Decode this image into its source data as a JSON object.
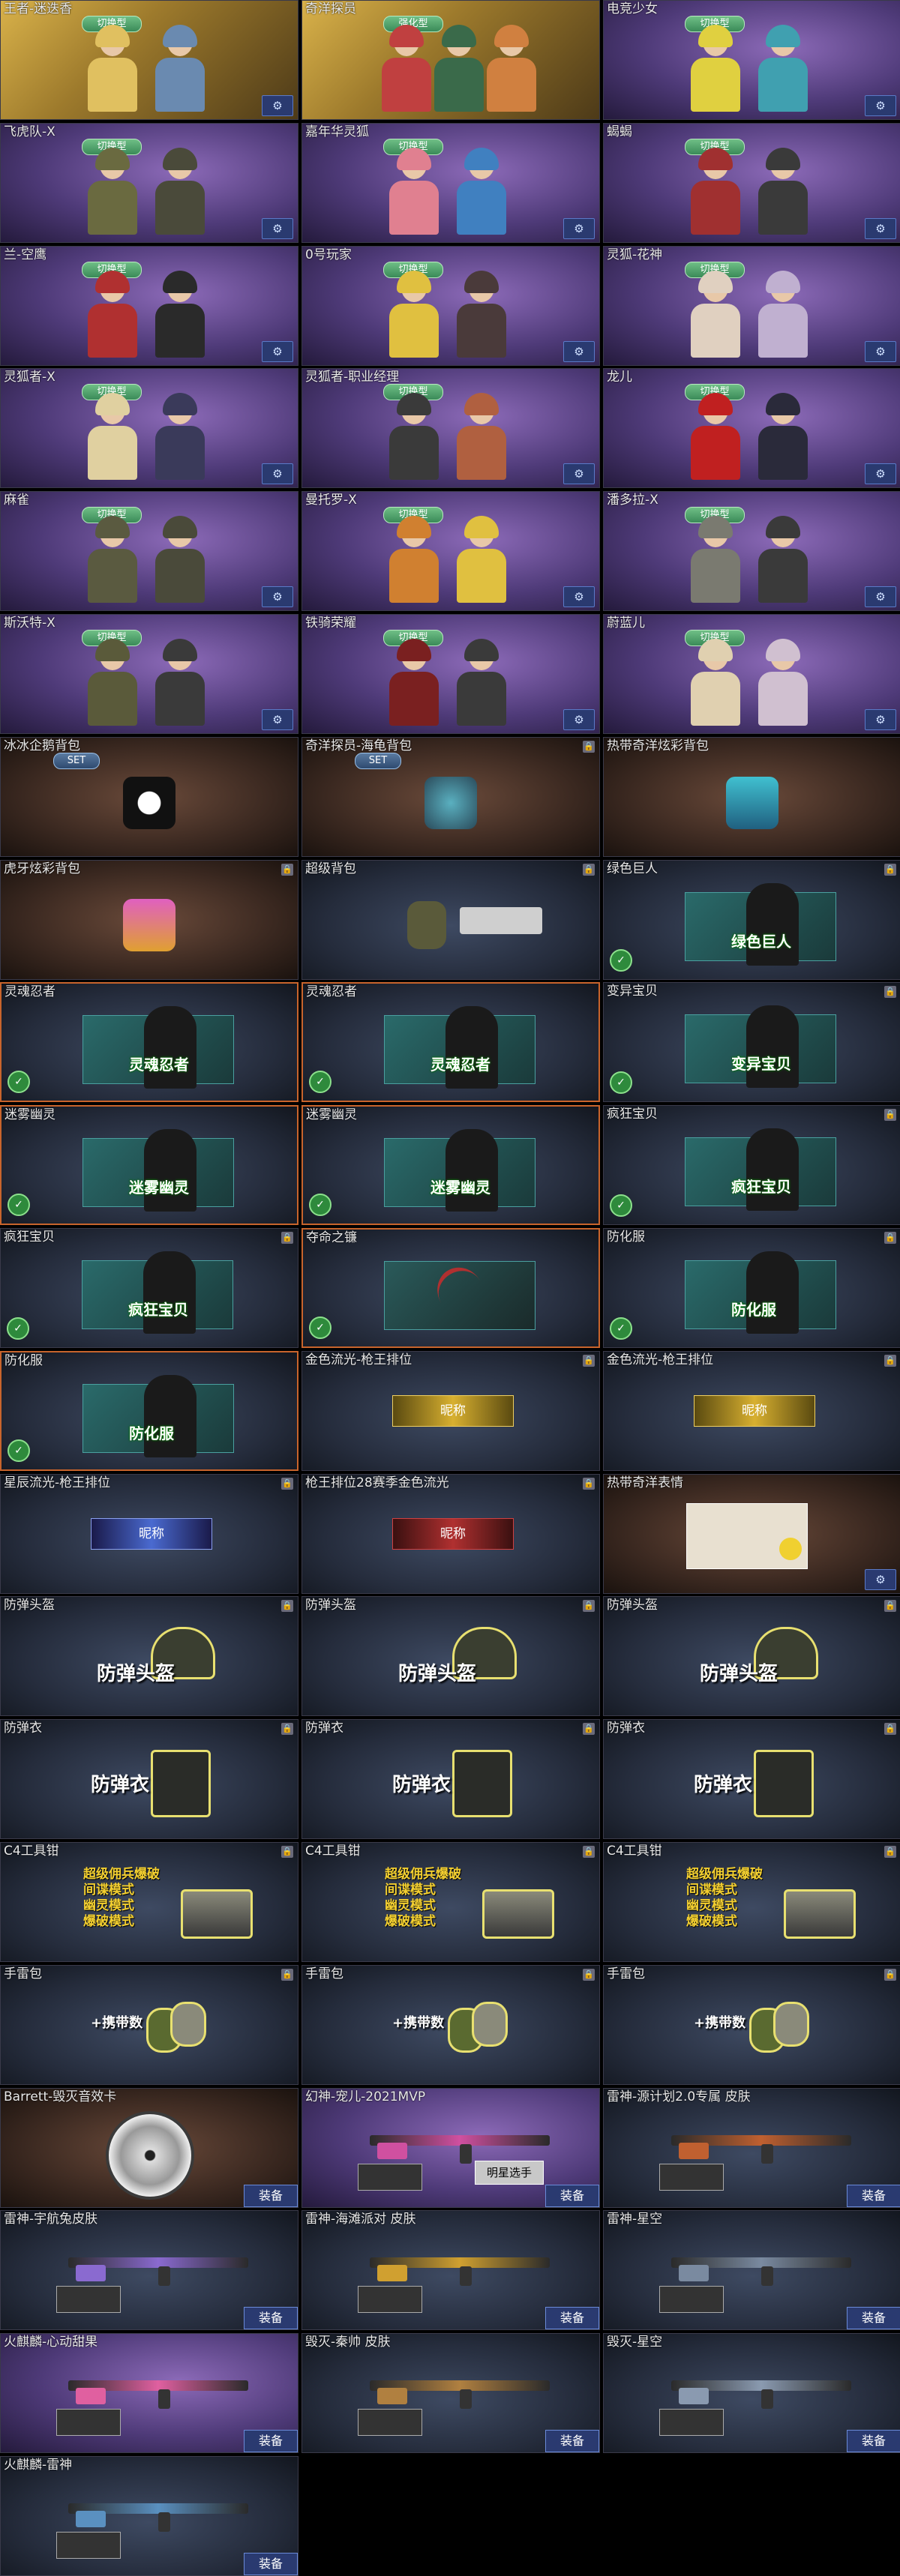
{
  "labels": {
    "gear": "⚙",
    "lock": "🔒",
    "equip": "装备",
    "tick": "✓"
  },
  "cards": [
    {
      "title": "王者-迷迭香",
      "style": "gold",
      "kind": "char",
      "badge": "切换型",
      "gear": true,
      "colors": [
        "#e0c060",
        "#6a8ab0"
      ]
    },
    {
      "title": "奇洋探员",
      "style": "gold",
      "kind": "char",
      "badge": "强化型",
      "gear": false,
      "colors": [
        "#c04040",
        "#3a6a4a",
        "#d08040"
      ]
    },
    {
      "title": "电竞少女",
      "style": "purple",
      "kind": "char",
      "badge": "切换型",
      "gear": true,
      "colors": [
        "#e0d040",
        "#40a0b0"
      ]
    },
    {
      "title": "飞虎队-X",
      "style": "purple",
      "kind": "char",
      "badge": "切换型",
      "gear": true,
      "colors": [
        "#6a6a40",
        "#4a4a3a"
      ]
    },
    {
      "title": "嘉年华灵狐",
      "style": "purple",
      "kind": "char",
      "badge": "切换型",
      "gear": true,
      "colors": [
        "#e08090",
        "#4080c0"
      ]
    },
    {
      "title": "蝎蝎",
      "style": "purple",
      "kind": "char",
      "badge": "切换型",
      "gear": true,
      "colors": [
        "#a03030",
        "#3a3a3a"
      ]
    },
    {
      "title": "兰-空鹰",
      "style": "purple",
      "kind": "char",
      "badge": "切换型",
      "gear": true,
      "colors": [
        "#b03030",
        "#2a2a2a"
      ]
    },
    {
      "title": "0号玩家",
      "style": "purple",
      "kind": "char",
      "badge": "切换型",
      "gear": true,
      "colors": [
        "#e0c040",
        "#4a3a3a"
      ]
    },
    {
      "title": "灵狐-花神",
      "style": "purple",
      "kind": "char",
      "badge": "切换型",
      "gear": true,
      "colors": [
        "#e0d0c0",
        "#c0b0d0"
      ]
    },
    {
      "title": "灵狐者-X",
      "style": "purple",
      "kind": "char",
      "badge": "切换型",
      "gear": true,
      "colors": [
        "#e0d0a0",
        "#3a3a5a"
      ]
    },
    {
      "title": "灵狐者-职业经理",
      "style": "purple",
      "kind": "char",
      "badge": "切换型",
      "gear": true,
      "colors": [
        "#3a3a3a",
        "#b06040"
      ]
    },
    {
      "title": "龙儿",
      "style": "purple",
      "kind": "char",
      "badge": "切换型",
      "gear": true,
      "colors": [
        "#c02020",
        "#2a2a3a"
      ]
    },
    {
      "title": "麻雀",
      "style": "purple",
      "kind": "char",
      "badge": "切换型",
      "gear": true,
      "colors": [
        "#5a5a40",
        "#4a4a3a"
      ]
    },
    {
      "title": "曼托罗-X",
      "style": "purple",
      "kind": "char",
      "badge": "切换型",
      "gear": true,
      "colors": [
        "#d08030",
        "#e0c040"
      ]
    },
    {
      "title": "潘多拉-X",
      "style": "purple",
      "kind": "char",
      "badge": "切换型",
      "gear": true,
      "colors": [
        "#7a7a70",
        "#3a3a3a"
      ]
    },
    {
      "title": "斯沃特-X",
      "style": "purple",
      "kind": "char",
      "badge": "切换型",
      "gear": true,
      "colors": [
        "#5a5a3a",
        "#3a3a3a"
      ]
    },
    {
      "title": "铁骑荣耀",
      "style": "purple",
      "kind": "char",
      "badge": "切换型",
      "gear": true,
      "colors": [
        "#7a2020",
        "#3a3a3a"
      ]
    },
    {
      "title": "蔚蓝儿",
      "style": "purple",
      "kind": "char",
      "badge": "切换型",
      "gear": true,
      "colors": [
        "#e0d0b0",
        "#d0c0d0"
      ]
    },
    {
      "title": "冰冰企鹅背包",
      "style": "brown",
      "kind": "pack",
      "badge": "SET",
      "lock": false,
      "icon": "penguin"
    },
    {
      "title": "奇洋探员-海龟背包",
      "style": "brown",
      "kind": "pack",
      "badge": "SET",
      "lock": true,
      "icon": "turtle"
    },
    {
      "title": "热带奇洋炫彩背包",
      "style": "brown",
      "kind": "pack",
      "badge": "",
      "lock": false,
      "icon": "bag"
    },
    {
      "title": "虎牙炫彩背包",
      "style": "brown",
      "kind": "pack",
      "badge": "",
      "lock": true,
      "icon": "tigerbag"
    },
    {
      "title": "超级背包",
      "style": "dark",
      "kind": "superpack",
      "badge": "",
      "lock": true
    },
    {
      "title": "绿色巨人",
      "style": "dark",
      "kind": "panel",
      "panel_label": "绿色巨人",
      "hl": false,
      "lock": true
    },
    {
      "title": "灵魂忍者",
      "style": "dark",
      "kind": "panel",
      "panel_label": "灵魂忍者",
      "hl": true,
      "lock": false
    },
    {
      "title": "灵魂忍者",
      "style": "dark",
      "kind": "panel",
      "panel_label": "灵魂忍者",
      "hl": true,
      "lock": false
    },
    {
      "title": "变异宝贝",
      "style": "dark",
      "kind": "panel",
      "panel_label": "变异宝贝",
      "hl": false,
      "lock": true
    },
    {
      "title": "迷雾幽灵",
      "style": "dark",
      "kind": "panel",
      "panel_label": "迷雾幽灵",
      "hl": true,
      "lock": false
    },
    {
      "title": "迷雾幽灵",
      "style": "dark",
      "kind": "panel",
      "panel_label": "迷雾幽灵",
      "hl": true,
      "lock": false
    },
    {
      "title": "疯狂宝贝",
      "style": "dark",
      "kind": "panel",
      "panel_label": "疯狂宝贝",
      "hl": false,
      "lock": true
    },
    {
      "title": "疯狂宝贝",
      "style": "dark",
      "kind": "panel",
      "panel_label": "疯狂宝贝",
      "hl": false,
      "lock": true
    },
    {
      "title": "夺命之镰",
      "style": "dark",
      "kind": "scythe",
      "hl": true,
      "lock": false
    },
    {
      "title": "防化服",
      "style": "dark",
      "kind": "panel",
      "panel_label": "防化服",
      "hl": false,
      "lock": true
    },
    {
      "title": "防化服",
      "style": "dark",
      "kind": "panel",
      "panel_label": "防化服",
      "hl": true,
      "lock": false
    },
    {
      "title": "金色流光-枪王排位",
      "style": "dark",
      "kind": "nick",
      "nick": "昵称",
      "lock": true
    },
    {
      "title": "金色流光-枪王排位",
      "style": "dark",
      "kind": "nick",
      "nick": "昵称",
      "lock": true
    },
    {
      "title": "星辰流光-枪王排位",
      "style": "dark",
      "kind": "nick2",
      "nick": "昵称",
      "lock": true
    },
    {
      "title": "枪王排位28赛季金色流光",
      "style": "dark",
      "kind": "nick3",
      "nick": "昵称",
      "lock": true
    },
    {
      "title": "热带奇洋表情",
      "style": "brown",
      "kind": "emote",
      "lock": false
    },
    {
      "title": "防弹头盔",
      "style": "dark",
      "kind": "helmet",
      "label": "防弹头盔",
      "lock": true
    },
    {
      "title": "防弹头盔",
      "style": "dark",
      "kind": "helmet",
      "label": "防弹头盔",
      "lock": true
    },
    {
      "title": "防弹头盔",
      "style": "dark",
      "kind": "helmet",
      "label": "防弹头盔",
      "lock": true
    },
    {
      "title": "防弹衣",
      "style": "dark",
      "kind": "vest",
      "label": "防弹衣",
      "lock": true
    },
    {
      "title": "防弹衣",
      "style": "dark",
      "kind": "vest",
      "label": "防弹衣",
      "lock": true
    },
    {
      "title": "防弹衣",
      "style": "dark",
      "kind": "vest",
      "label": "防弹衣",
      "lock": true
    },
    {
      "title": "C4工具钳",
      "style": "dark",
      "kind": "c4",
      "lines": [
        "超级佣兵爆破",
        "间谍模式",
        "幽灵模式",
        "爆破模式"
      ],
      "lock": true
    },
    {
      "title": "C4工具钳",
      "style": "dark",
      "kind": "c4",
      "lines": [
        "超级佣兵爆破",
        "间谍模式",
        "幽灵模式",
        "爆破模式"
      ],
      "lock": true
    },
    {
      "title": "C4工具钳",
      "style": "dark",
      "kind": "c4",
      "lines": [
        "超级佣兵爆破",
        "间谍模式",
        "幽灵模式",
        "爆破模式"
      ],
      "lock": true
    },
    {
      "title": "手雷包",
      "style": "dark",
      "kind": "grenade",
      "label": "+携带数",
      "lock": true
    },
    {
      "title": "手雷包",
      "style": "dark",
      "kind": "grenade",
      "label": "+携带数",
      "lock": true
    },
    {
      "title": "手雷包",
      "style": "dark",
      "kind": "grenade",
      "label": "+携带数",
      "lock": true
    },
    {
      "title": "Barrett-毁灭音效卡",
      "style": "brown",
      "kind": "disc",
      "equip": true
    },
    {
      "title": "幻神-宠儿-2021MVP",
      "style": "purple",
      "kind": "gun",
      "gunColor": "#d050a0",
      "tag": "明星选手",
      "equip": true
    },
    {
      "title": "雷神-源计划2.0专属 皮肤",
      "style": "dark",
      "kind": "gun",
      "gunColor": "#c06030",
      "tag": "",
      "equip": true
    },
    {
      "title": "雷神-宇航兔皮肤",
      "style": "dark",
      "kind": "gun",
      "gunColor": "#8a6ad0",
      "tag": "",
      "equip": true
    },
    {
      "title": "雷神-海滩派对 皮肤",
      "style": "dark",
      "kind": "gun",
      "gunColor": "#d0a030",
      "tag": "",
      "equip": true
    },
    {
      "title": "雷神-星空",
      "style": "dark",
      "kind": "gun",
      "gunColor": "#7a8aa0",
      "tag": "",
      "equip": true
    },
    {
      "title": "火麒麟-心动甜果",
      "style": "purple",
      "kind": "gun",
      "gunColor": "#e060a0",
      "tag": "",
      "equip": true
    },
    {
      "title": "毁灭-秦帅 皮肤",
      "style": "dark",
      "kind": "gun",
      "gunColor": "#b08040",
      "tag": "",
      "equip": true
    },
    {
      "title": "毁灭-星空",
      "style": "dark",
      "kind": "gun",
      "gunColor": "#8a9ab0",
      "tag": "",
      "equip": true
    },
    {
      "title": "火麒麟-雷神",
      "style": "dark",
      "kind": "gun",
      "gunColor": "#5a90c0",
      "tag": "",
      "equip": true
    }
  ]
}
